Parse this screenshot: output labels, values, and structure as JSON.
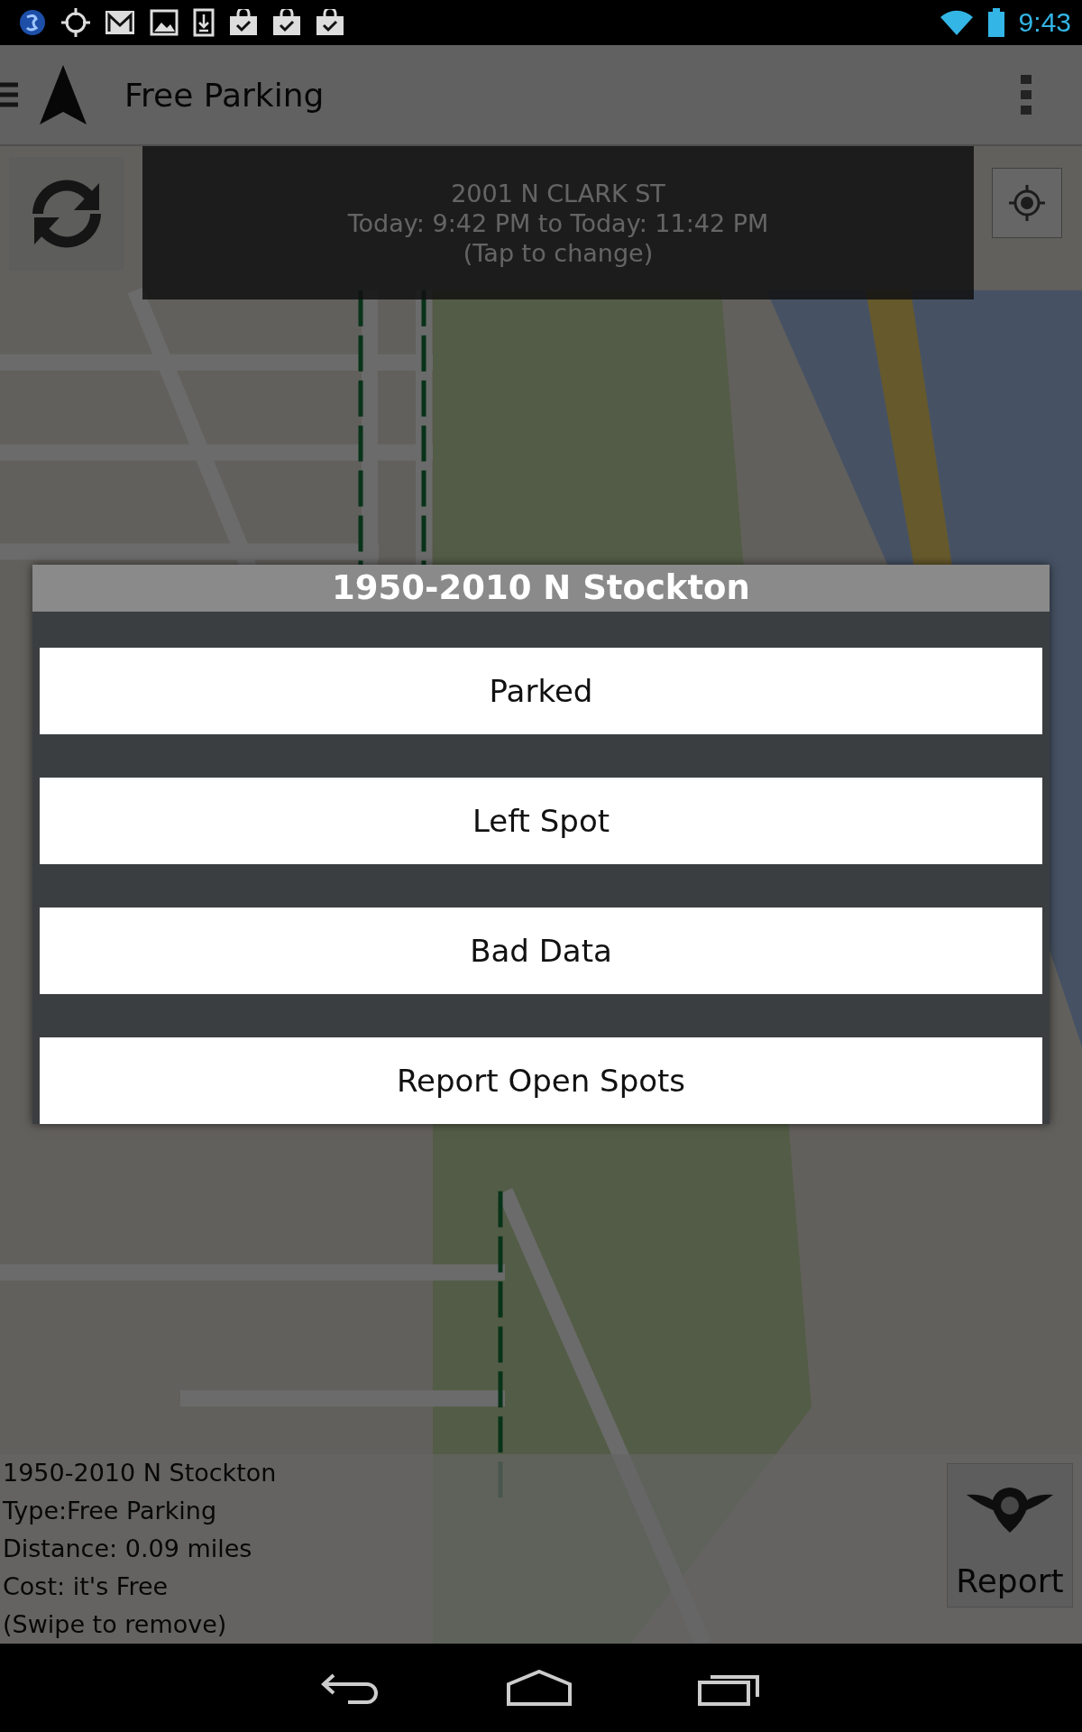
{
  "status_bar": {
    "time": "9:43"
  },
  "app_bar": {
    "title": "Free Parking"
  },
  "banner": {
    "lines": [
      "2001 N CLARK ST",
      "Today: 9:42 PM to Today: 11:42 PM",
      "(Tap to change)"
    ]
  },
  "info_panel": {
    "lines": [
      "1950-2010 N Stockton",
      "Type:Free Parking",
      "Distance: 0.09 miles",
      "Cost: it's Free",
      "(Swipe to remove)"
    ]
  },
  "report_button": {
    "label": "Report"
  },
  "dialog": {
    "title": "1950-2010 N Stockton",
    "options": [
      "Parked",
      "Left Spot",
      "Bad Data",
      "Report Open Spots"
    ]
  }
}
